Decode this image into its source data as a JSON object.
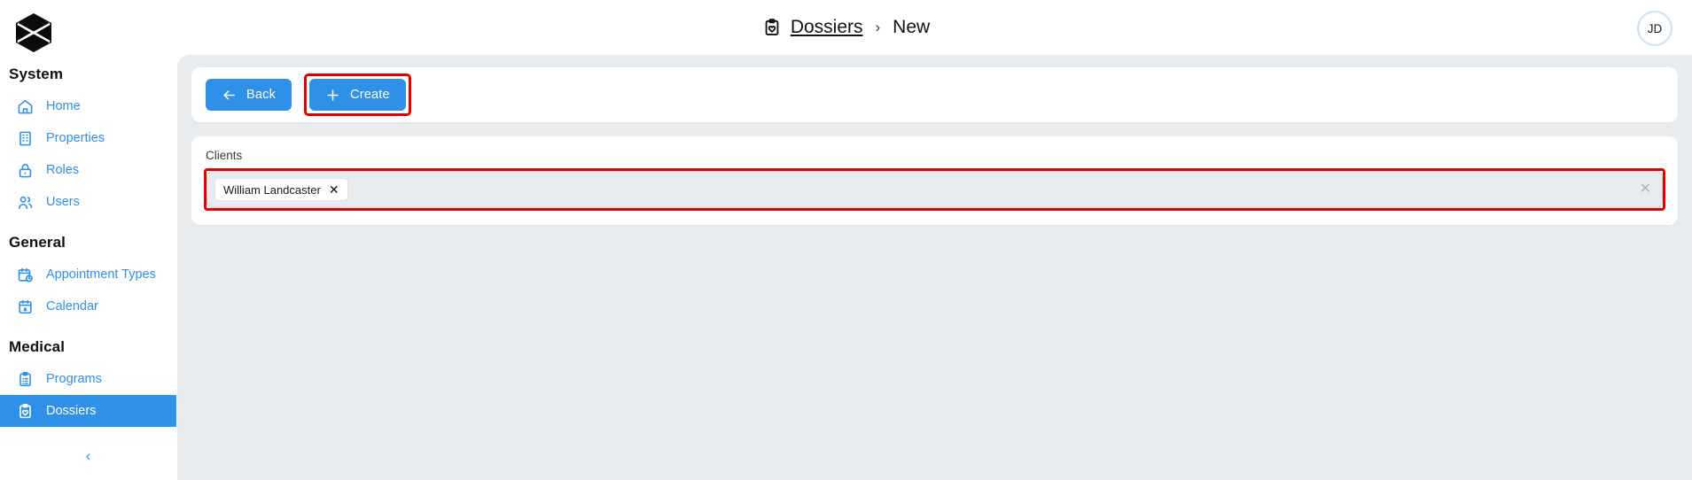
{
  "app": {
    "logo_name": "hexagon-x-logo",
    "accent_color": "#2f90e8",
    "annotation_color": "#e00000",
    "content_bg": "#e9ecef"
  },
  "sidebar": {
    "sections": [
      {
        "title": "System",
        "items": [
          {
            "label": "Home",
            "icon": "home-icon",
            "active": false
          },
          {
            "label": "Properties",
            "icon": "building-icon",
            "active": false
          },
          {
            "label": "Roles",
            "icon": "lock-icon",
            "active": false
          },
          {
            "label": "Users",
            "icon": "users-icon",
            "active": false
          }
        ]
      },
      {
        "title": "General",
        "items": [
          {
            "label": "Appointment Types",
            "icon": "calendar-clock-icon",
            "active": false
          },
          {
            "label": "Calendar",
            "icon": "calendar-icon",
            "active": false
          }
        ]
      },
      {
        "title": "Medical",
        "items": [
          {
            "label": "Programs",
            "icon": "clipboard-list-icon",
            "active": false
          },
          {
            "label": "Dossiers",
            "icon": "clipboard-heart-icon",
            "active": true
          }
        ]
      }
    ],
    "collapse_label": "‹"
  },
  "header": {
    "breadcrumb": {
      "icon": "clipboard-heart-icon",
      "link": "Dossiers",
      "separator": "›",
      "current": "New"
    },
    "avatar_initials": "JD"
  },
  "toolbar": {
    "back_label": "Back",
    "create_label": "Create"
  },
  "form": {
    "clients": {
      "label": "Clients",
      "placeholder": "",
      "chips": [
        {
          "label": "William Landcaster",
          "remove": "✕"
        }
      ],
      "clear_label": "✕"
    }
  }
}
